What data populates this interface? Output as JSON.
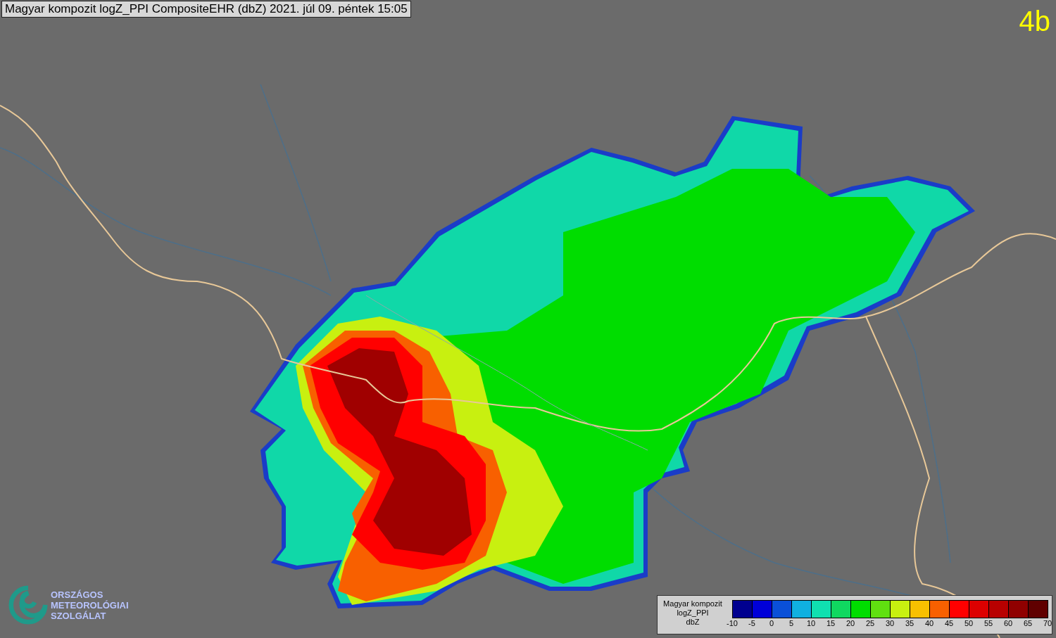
{
  "title": "Magyar kompozit logZ_PPI CompositeEHR (dbZ) 2021. júl 09. péntek 15:05",
  "panel_label": "4b",
  "logo": {
    "lines": [
      "ORSZÁGOS",
      "METEOROLÓGIAI",
      "SZOLGÁLAT"
    ]
  },
  "legend": {
    "lines": [
      "Magyar kompozit",
      "logZ_PPI",
      "dbZ"
    ],
    "bins": [
      {
        "color": "#00008f"
      },
      {
        "color": "#0000d8"
      },
      {
        "color": "#0a50d8"
      },
      {
        "color": "#10b0e0"
      },
      {
        "color": "#10e0b0"
      },
      {
        "color": "#10d860"
      },
      {
        "color": "#00dd00"
      },
      {
        "color": "#60e010"
      },
      {
        "color": "#c8f010"
      },
      {
        "color": "#f8c000"
      },
      {
        "color": "#f86000"
      },
      {
        "color": "#ff0000"
      },
      {
        "color": "#dd0000"
      },
      {
        "color": "#b80000"
      },
      {
        "color": "#900000"
      },
      {
        "color": "#600000"
      }
    ],
    "ticks": [
      "-10",
      "-5",
      "0",
      "5",
      "10",
      "15",
      "20",
      "25",
      "30",
      "35",
      "40",
      "45",
      "50",
      "55",
      "60",
      "65",
      "70"
    ]
  }
}
